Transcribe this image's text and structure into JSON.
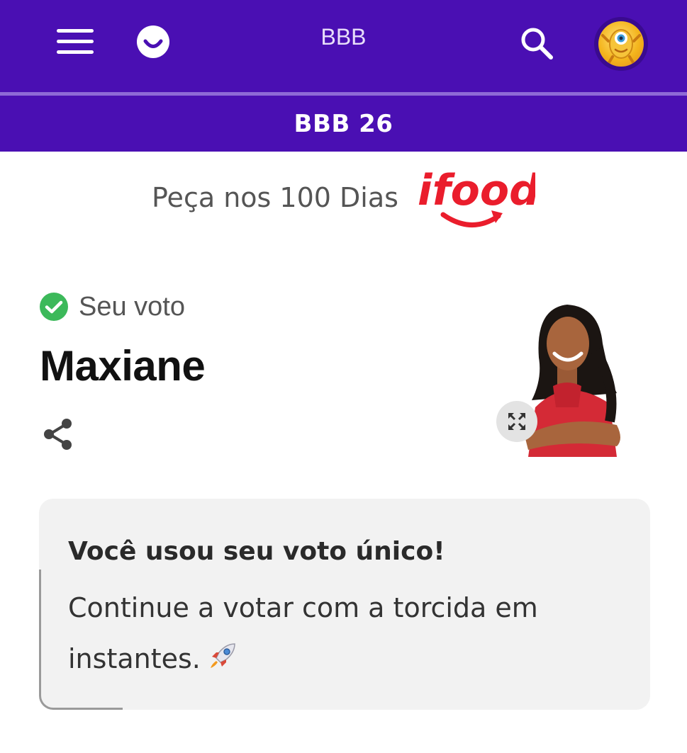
{
  "header": {
    "app_title": "BBB",
    "section_title": "BBB 26",
    "icons": {
      "menu": "hamburger-menu-icon",
      "logo": "smile-logo-icon",
      "search": "search-icon",
      "avatar": "big-brother-eye-avatar"
    }
  },
  "ad": {
    "text": "Peça nos 100 Dias",
    "brand": "ifood",
    "brand_color": "#ea1d2c"
  },
  "vote": {
    "status_label": "Seu voto",
    "status_color": "#3cb95a",
    "candidate": "Maxiane",
    "share_icon": "share-icon",
    "expand_icon": "expand-icon"
  },
  "notice": {
    "title": "Você usou seu voto único!",
    "body": "Continue a votar com a torcida em instantes.",
    "emoji_icon": "rocket-icon"
  },
  "colors": {
    "primary": "#4a0fb3",
    "card_bg": "#f2f2f2"
  }
}
